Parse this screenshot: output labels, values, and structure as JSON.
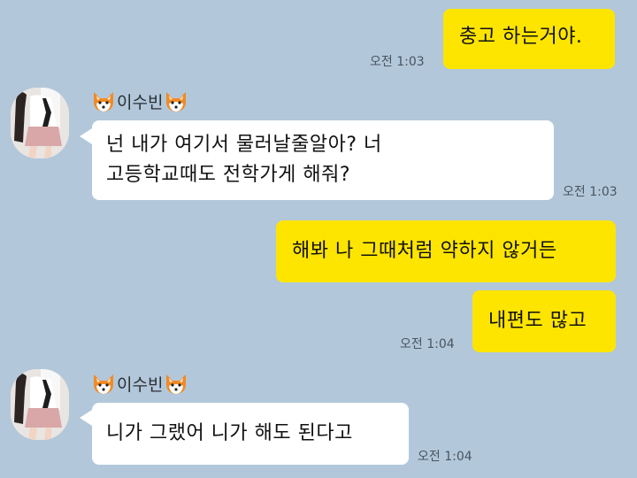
{
  "messages": [
    {
      "sender": "me",
      "text": "충고 하는거야.",
      "time": "오전 1:03"
    },
    {
      "sender": "이수빈",
      "text": "넌 내가 여기서 물러날줄알아? 너\n고등학교때도 전학가게 해줘?",
      "time": "오전 1:03"
    },
    {
      "sender": "me",
      "text": "해봐 나 그때처럼 약하지 않거든",
      "time": ""
    },
    {
      "sender": "me",
      "text": "내편도 많고",
      "time": "오전 1:04"
    },
    {
      "sender": "이수빈",
      "text": "니가 그랬어 니가 해도 된다고",
      "time": "오전 1:04"
    }
  ],
  "contact": {
    "name": "이수빈",
    "name_decoration_icon": "fox-emoji",
    "avatar_icon": "profile-photo"
  },
  "colors": {
    "background": "#b2c7da",
    "my_bubble": "#fee500",
    "other_bubble": "#ffffff"
  }
}
